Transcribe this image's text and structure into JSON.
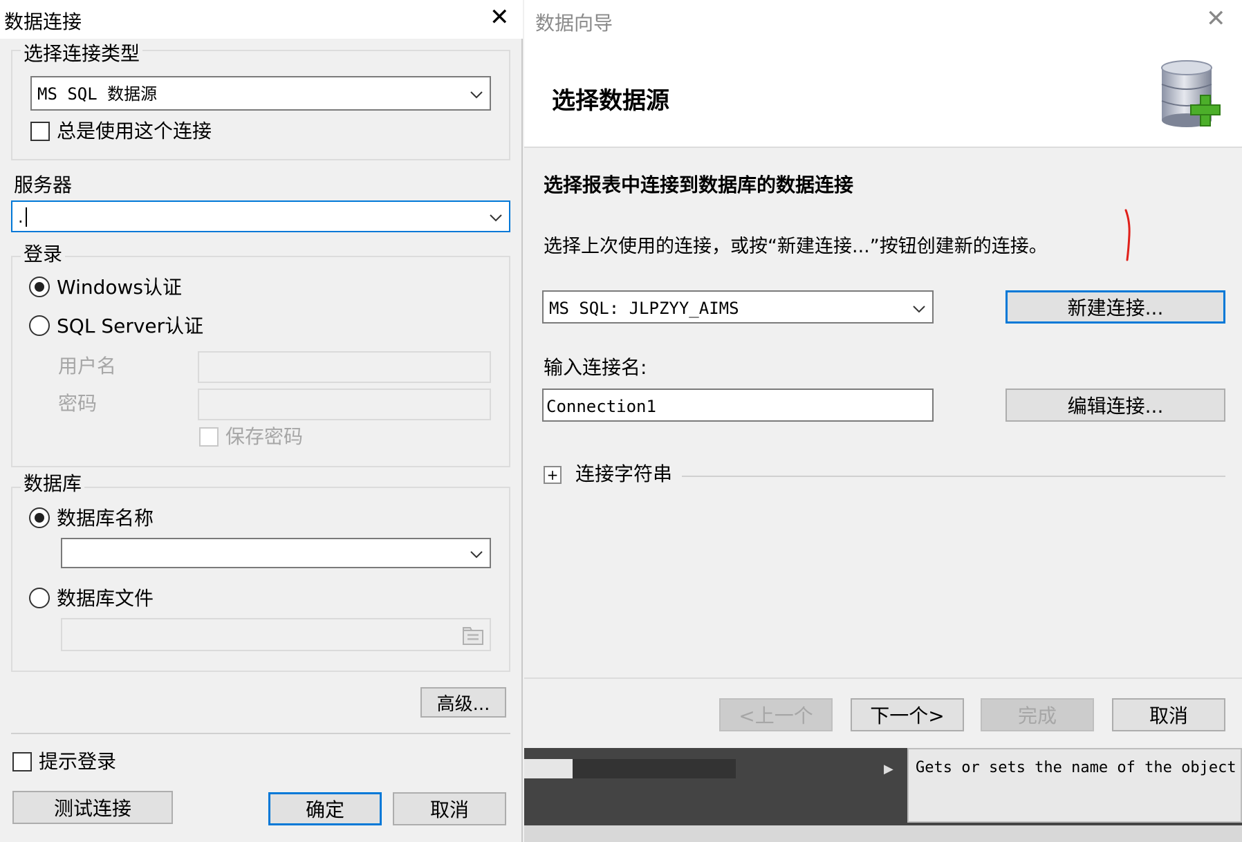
{
  "left_dialog": {
    "title": "数据连接",
    "connection_type": {
      "legend": "选择连接类型",
      "selected": "MS SQL 数据源",
      "always_use_label": "总是使用这个连接"
    },
    "server": {
      "label": "服务器",
      "value": "."
    },
    "login": {
      "legend": "登录",
      "windows_auth": "Windows认证",
      "sql_auth": "SQL Server认证",
      "username_label": "用户名",
      "password_label": "密码",
      "save_password": "保存密码"
    },
    "database": {
      "legend": "数据库",
      "name_option": "数据库名称",
      "file_option": "数据库文件"
    },
    "advanced_button": "高级...",
    "prompt_login": "提示登录",
    "test_button": "测试连接",
    "ok_button": "确定",
    "cancel_button": "取消"
  },
  "right_dialog": {
    "title": "数据向导",
    "header_title": "选择数据源",
    "section_title": "选择报表中连接到数据库的数据连接",
    "instructions": "选择上次使用的连接，或按“新建连接...”按钮创建新的连接。",
    "connection_selected": "MS SQL: JLPZYY_AIMS",
    "new_connection_button": "新建连接...",
    "connection_name_label": "输入连接名:",
    "connection_name_value": "Connection1",
    "edit_connection_button": "编辑连接...",
    "connection_string_label": "连接字符串",
    "back_button": "<上一个",
    "next_button": "下一个>",
    "finish_button": "完成",
    "cancel_button": "取消"
  },
  "background": {
    "description_text": "Gets or sets the name of the object"
  },
  "colors": {
    "focus_blue": "#0078d7",
    "annotation_red": "#e0201a"
  }
}
